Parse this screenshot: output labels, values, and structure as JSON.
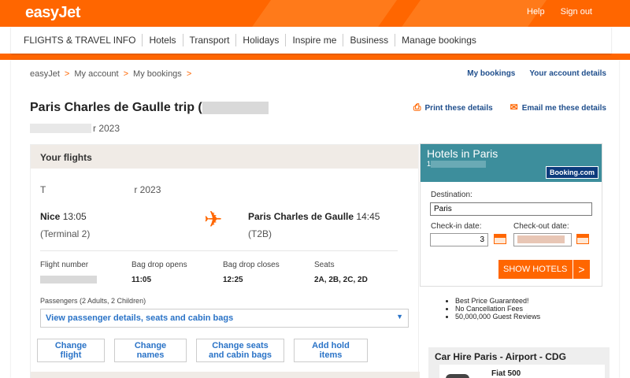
{
  "header": {
    "logo": "easyJet",
    "links": [
      "Help",
      "Sign out"
    ]
  },
  "nav": [
    "FLIGHTS & TRAVEL INFO",
    "Hotels",
    "Transport",
    "Holidays",
    "Inspire me",
    "Business",
    "Manage bookings"
  ],
  "breadcrumb": [
    "easyJet",
    "My account",
    "My bookings"
  ],
  "account_links": {
    "my_bookings": "My bookings",
    "account_details": "Your account details"
  },
  "trip": {
    "title": "Paris Charles de Gaulle trip",
    "title_suffix": "(",
    "date_partial": "r 2023"
  },
  "share": {
    "print": "Print these details",
    "email": "Email me these details"
  },
  "flights": {
    "heading": "Your flights",
    "date_prefix": "T",
    "date_suffix": "r 2023",
    "dep_city": "Nice",
    "dep_time": "13:05",
    "dep_terminal": "(Terminal 2)",
    "arr_city": "Paris Charles de Gaulle",
    "arr_time": "14:45",
    "arr_terminal": "(T2B)",
    "info": [
      {
        "label": "Flight number",
        "value": ""
      },
      {
        "label": "Bag drop opens",
        "value": "11:05"
      },
      {
        "label": "Bag drop closes",
        "value": "12:25"
      },
      {
        "label": "Seats",
        "value": "2A, 2B, 2C, 2D"
      }
    ],
    "passengers": "Passengers (2 Adults, 2 Children)",
    "view_details": "View passenger details, seats and cabin bags",
    "buttons": [
      "Change flight",
      "Change names",
      "Change seats and cabin bags",
      "Add hold items"
    ]
  },
  "hotels": {
    "title": "Hotels in Paris",
    "subtitle": "1",
    "partner": "Booking.com",
    "destination_label": "Destination:",
    "destination_value": "Paris",
    "checkin_label": "Check-in date:",
    "checkin_value": "3",
    "checkout_label": "Check-out date:",
    "show_button": "SHOW HOTELS",
    "show_arrow": ">",
    "benefits": [
      "Best Price Guaranteed!",
      "No Cancellation Fees",
      "50,000,000 Guest Reviews"
    ]
  },
  "car_hire": {
    "title": "Car Hire Paris - Airport - CDG",
    "model": "Fiat 500"
  },
  "colors": {
    "brand": "#ff6600",
    "link": "#1f4e8c",
    "accent_link": "#2a73c7",
    "hotels_header": "#3d8e9c"
  }
}
